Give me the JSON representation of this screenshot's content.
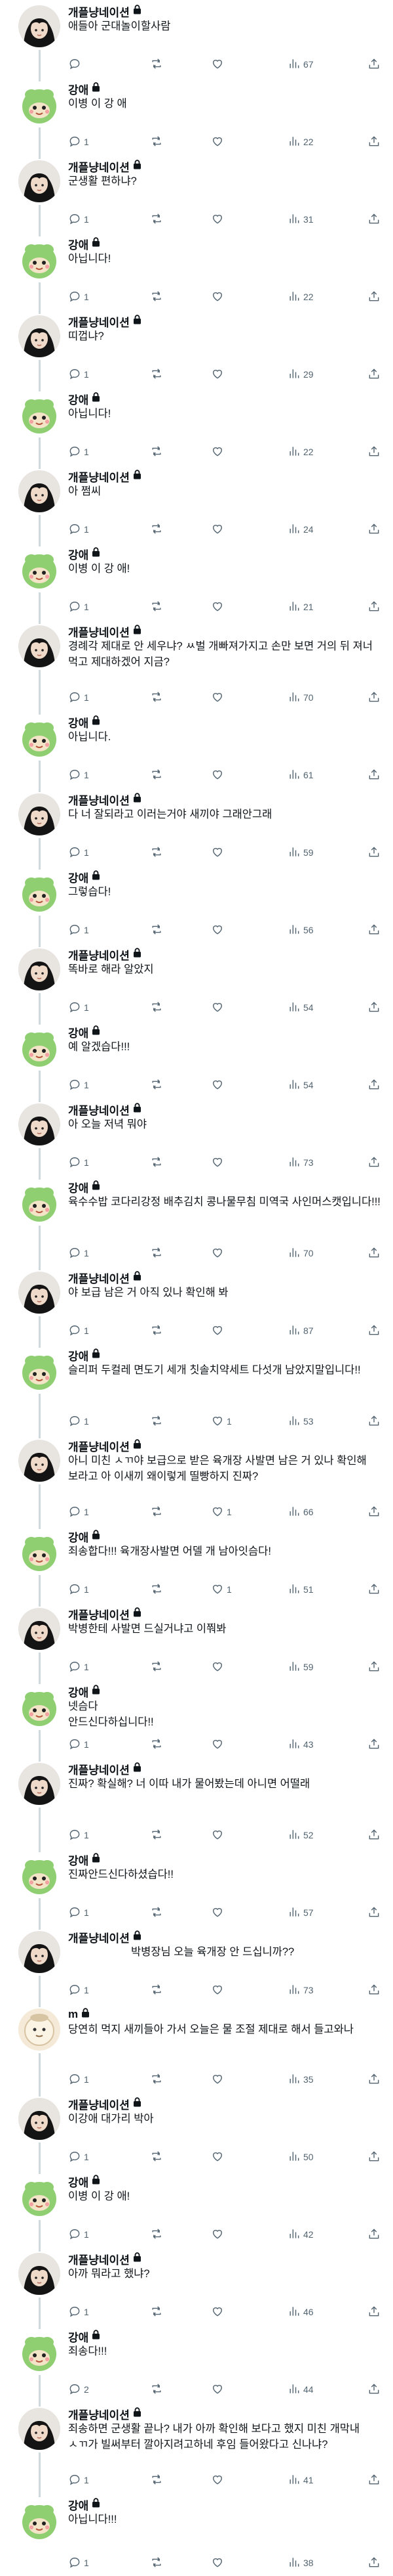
{
  "posts": [
    {
      "user": "개플냥네이션",
      "lock": true,
      "avatar": "dark",
      "text": "애들아 군대놀이할사람",
      "replies": "",
      "retweets": "",
      "likes": "",
      "views": "67"
    },
    {
      "user": "강애",
      "lock": true,
      "avatar": "green",
      "text": "이병 이 강 애",
      "replies": "1",
      "retweets": "",
      "likes": "",
      "views": "22"
    },
    {
      "user": "개플냥네이션",
      "lock": true,
      "avatar": "dark",
      "text": "군생활 편하냐?",
      "replies": "1",
      "retweets": "",
      "likes": "",
      "views": "31"
    },
    {
      "user": "강애",
      "lock": true,
      "avatar": "green",
      "text": "아닙니다!",
      "replies": "1",
      "retweets": "",
      "likes": "",
      "views": "22"
    },
    {
      "user": "개플냥네이션",
      "lock": true,
      "avatar": "dark",
      "text": "띠껍냐?",
      "replies": "1",
      "retweets": "",
      "likes": "",
      "views": "29"
    },
    {
      "user": "강애",
      "lock": true,
      "avatar": "green",
      "text": "아닙니다!",
      "replies": "1",
      "retweets": "",
      "likes": "",
      "views": "22"
    },
    {
      "user": "개플냥네이션",
      "lock": true,
      "avatar": "dark",
      "text": "아 쩜씨",
      "replies": "1",
      "retweets": "",
      "likes": "",
      "views": "24"
    },
    {
      "user": "강애",
      "lock": true,
      "avatar": "green",
      "text": "이병 이 강 애!",
      "replies": "1",
      "retweets": "",
      "likes": "",
      "views": "21"
    },
    {
      "user": "개플냥네이션",
      "lock": true,
      "avatar": "dark",
      "text": "경례각 제대로 안 세우냐? ㅆ벌 개빠져가지고 손만 보면 거의 뒤 져너 먹고 제대하겠어 지금?",
      "replies": "1",
      "retweets": "",
      "likes": "",
      "views": "70"
    },
    {
      "user": "강애",
      "lock": true,
      "avatar": "green",
      "text": "아닙니다.",
      "replies": "1",
      "retweets": "",
      "likes": "",
      "views": "61"
    },
    {
      "user": "개플냥네이션",
      "lock": true,
      "avatar": "dark",
      "text": "다 너 잘되라고 이러는거야 새끼야 그래안그래",
      "replies": "1",
      "retweets": "",
      "likes": "",
      "views": "59"
    },
    {
      "user": "강애",
      "lock": true,
      "avatar": "green",
      "text": "그렇습다!",
      "replies": "1",
      "retweets": "",
      "likes": "",
      "views": "56"
    },
    {
      "user": "개플냥네이션",
      "lock": true,
      "avatar": "dark",
      "text": "똑바로 해라 알았지",
      "replies": "1",
      "retweets": "",
      "likes": "",
      "views": "54"
    },
    {
      "user": "강애",
      "lock": true,
      "avatar": "green",
      "text": "예 알겠습다!!!",
      "replies": "1",
      "retweets": "",
      "likes": "",
      "views": "54"
    },
    {
      "user": "개플냥네이션",
      "lock": true,
      "avatar": "dark",
      "text": "아 오늘 저녁 뭐야",
      "replies": "1",
      "retweets": "",
      "likes": "",
      "views": "73"
    },
    {
      "user": "강애",
      "lock": true,
      "avatar": "green",
      "text": "육수수밥 코다리강정 배추김치 콩나물무침 미역국 사인머스캣입니다!!!",
      "replies": "1",
      "retweets": "",
      "likes": "",
      "views": "70"
    },
    {
      "user": "개플냥네이션",
      "lock": true,
      "avatar": "dark",
      "text": "야 보급 남은 거 아직 있나 확인해 봐",
      "replies": "1",
      "retweets": "",
      "likes": "",
      "views": "87"
    },
    {
      "user": "강애",
      "lock": true,
      "avatar": "green",
      "text": "슬리퍼 두컬레 면도기 세개 칫솔치약세트 다섯개 남았지말입니다!!",
      "replies": "1",
      "retweets": "",
      "likes": "1",
      "views": "53"
    },
    {
      "user": "개플냥네이션",
      "lock": true,
      "avatar": "dark",
      "text": "아니 미친 ㅅㄲ야 보급으로 받은 육개장 사발면 남은 거 있나 확인해 보라고 아 이새끼 왜이렇게 띨빵하지 진짜?",
      "replies": "1",
      "retweets": "",
      "likes": "1",
      "views": "66"
    },
    {
      "user": "강애",
      "lock": true,
      "avatar": "green",
      "text": "죄송합다!!! 육개장사발면 어델 개 남아잇슴다!",
      "replies": "1",
      "retweets": "",
      "likes": "1",
      "views": "51"
    },
    {
      "user": "개플냥네이션",
      "lock": true,
      "avatar": "dark",
      "text": "박병한테 사발면 드실거냐고 이쭤봐",
      "replies": "1",
      "retweets": "",
      "likes": "",
      "views": "59"
    },
    {
      "user": "강애",
      "lock": true,
      "avatar": "green",
      "text": "넷슴다\n안드신다하십니다!!",
      "replies": "1",
      "retweets": "",
      "likes": "",
      "views": "43"
    },
    {
      "user": "개플냥네이션",
      "lock": true,
      "avatar": "dark",
      "text": "진짜? 확실해? 너 이따 내가 물어봤는데 아니면 어떨래",
      "replies": "1",
      "retweets": "",
      "likes": "",
      "views": "52"
    },
    {
      "user": "강애",
      "lock": true,
      "avatar": "green",
      "text": "진짜안드신다하셨습다!!",
      "replies": "1",
      "retweets": "",
      "likes": "",
      "views": "57"
    },
    {
      "user": "개플냥네이션",
      "lock": true,
      "avatar": "dark",
      "text": "박병장님 오늘 육개장 안 드십니까??",
      "indent": true,
      "replies": "1",
      "retweets": "",
      "likes": "",
      "views": "73"
    },
    {
      "user": "m",
      "lock": true,
      "avatar": "beige",
      "text": "당연히 먹지 새끼들아 가서 오늘은 물 조절 제대로 해서 들고와나",
      "replies": "1",
      "retweets": "",
      "likes": "",
      "views": "35"
    },
    {
      "user": "개플냥네이션",
      "lock": true,
      "avatar": "dark",
      "text": "이강애 대가리 박아",
      "replies": "1",
      "retweets": "",
      "likes": "",
      "views": "50"
    },
    {
      "user": "강애",
      "lock": true,
      "avatar": "green",
      "text": "이병 이 강 애!",
      "replies": "1",
      "retweets": "",
      "likes": "",
      "views": "42"
    },
    {
      "user": "개플냥네이션",
      "lock": true,
      "avatar": "dark",
      "text": "아까 뭐라고 했냐?",
      "replies": "1",
      "retweets": "",
      "likes": "",
      "views": "46"
    },
    {
      "user": "강애",
      "lock": true,
      "avatar": "green",
      "text": "죄송다!!!",
      "replies": "2",
      "retweets": "",
      "likes": "",
      "views": "44"
    },
    {
      "user": "개플냥네이션",
      "lock": true,
      "avatar": "dark",
      "text": "죄송하면 군생활 끝나? 내가 아까 확인해 보다고 했지 미친 개막내 ㅅㄲ가 빌써부터 깔아지려고하네 후임 들어왔다고 신나냐?",
      "replies": "1",
      "retweets": "",
      "likes": "",
      "views": "41"
    },
    {
      "user": "강애",
      "lock": true,
      "avatar": "green",
      "text": "아닙니다!!!",
      "replies": "1",
      "retweets": "",
      "likes": "",
      "views": "38"
    }
  ],
  "icons": {
    "reply": "reply-icon",
    "retweet": "retweet-icon",
    "like": "heart-icon",
    "views": "views-bar-icon",
    "share": "share-icon",
    "lock": "lock-icon"
  },
  "colors": {
    "text": "#0f1419",
    "meta": "#536471",
    "thread_line": "#cfd9de",
    "green_avatar": "#8fcf72"
  }
}
